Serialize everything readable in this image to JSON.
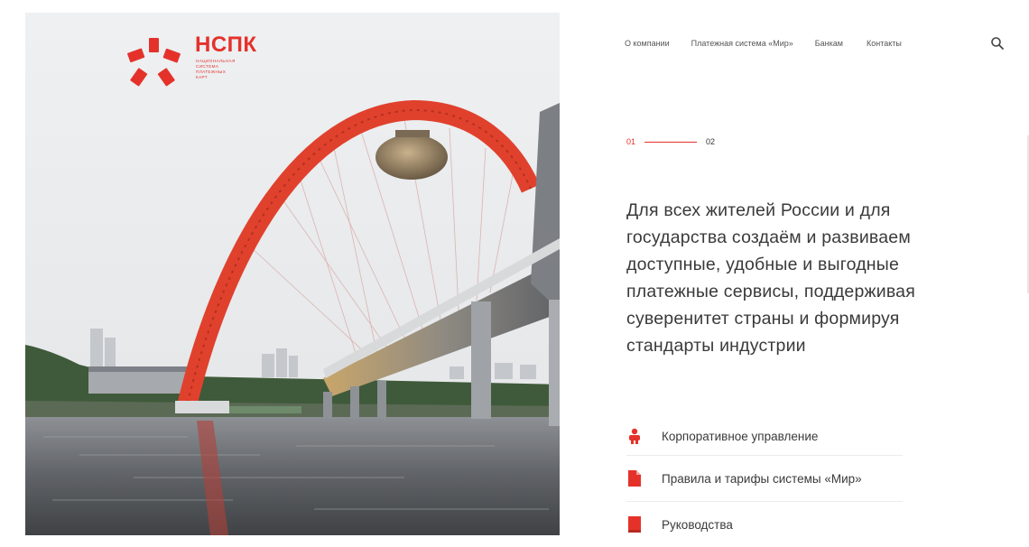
{
  "brand": {
    "name": "НСПК",
    "subtitle_lines": [
      "Национальная",
      "система",
      "платежных",
      "карт"
    ],
    "accent_color": "#e4322b"
  },
  "nav": {
    "items": [
      "О компании",
      "Платежная система «Мир»",
      "Банкам",
      "Контакты"
    ],
    "search_icon": "search-icon"
  },
  "slider": {
    "active": "01",
    "next": "02"
  },
  "headline": "Для всех жителей России и для государства создаём и развиваем доступные, удобные и выгодные платежные сервисы, поддерживая суверенитет страны и формируя стандарты индустрии",
  "links": [
    {
      "label": "Корпоративное управление",
      "icon": "people-icon"
    },
    {
      "label": "Правила и тарифы системы «Мир»",
      "icon": "document-icon"
    },
    {
      "label": "Руководства",
      "icon": "book-icon"
    }
  ]
}
